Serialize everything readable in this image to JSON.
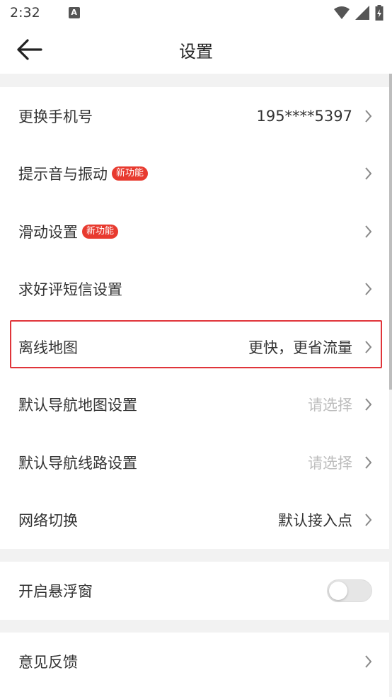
{
  "status_bar": {
    "time": "2:32",
    "notification_letter": "A"
  },
  "header": {
    "title": "设置"
  },
  "groups": [
    {
      "items": [
        {
          "label": "更换手机号",
          "value": "195****5397"
        },
        {
          "label": "提示音与振动",
          "badge": "新功能"
        },
        {
          "label": "滑动设置",
          "badge": "新功能"
        },
        {
          "label": "求好评短信设置"
        },
        {
          "label": "离线地图",
          "value": "更快，更省流量",
          "highlighted": true
        },
        {
          "label": "默认导航地图设置",
          "value": "请选择"
        },
        {
          "label": "默认导航线路设置",
          "value": "请选择"
        },
        {
          "label": "网络切换",
          "value": "默认接入点"
        }
      ]
    },
    {
      "items": [
        {
          "label": "开启悬浮窗",
          "toggle": false
        }
      ]
    },
    {
      "items": [
        {
          "label": "意见反馈"
        }
      ]
    }
  ],
  "colors": {
    "badge": "#e83a2f",
    "highlight_border": "#e0353a",
    "placeholder": "#bdbdbd"
  }
}
